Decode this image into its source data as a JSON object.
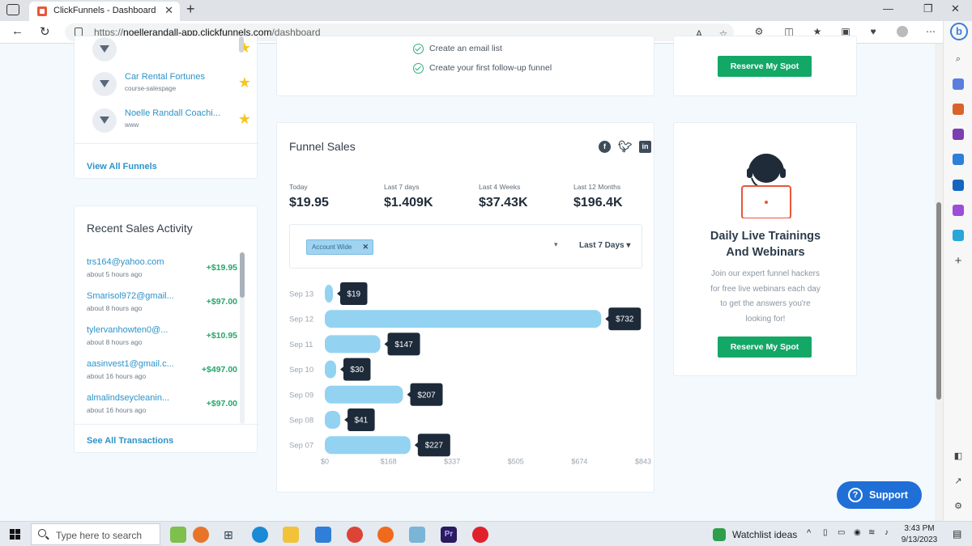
{
  "browser": {
    "tab_title": "ClickFunnels - Dashboard",
    "url_prefix": "https://",
    "url_host": "noellerandall-app.clickfunnels.com",
    "url_path": "/dashboard"
  },
  "funnels": {
    "items": [
      {
        "name": "Car Rental Fortunes",
        "sub": "course-salespage"
      },
      {
        "name": "Noelle Randall Coachi...",
        "sub": "www"
      }
    ],
    "view_all": "View All Funnels"
  },
  "checklist": [
    "Create an email list",
    "Create your first follow-up funnel"
  ],
  "promo_top": {
    "button": "Reserve My Spot"
  },
  "recent_sales": {
    "title": "Recent Sales Activity",
    "items": [
      {
        "email": "trs164@yahoo.com",
        "ago": "about 5 hours ago",
        "amount": "+$19.95"
      },
      {
        "email": "Smarisol972@gmail...",
        "ago": "about 8 hours ago",
        "amount": "+$97.00"
      },
      {
        "email": "tylervanhowten0@...",
        "ago": "about 8 hours ago",
        "amount": "+$10.95"
      },
      {
        "email": "aasinvest1@gmail.c...",
        "ago": "about 16 hours ago",
        "amount": "+$497.00"
      },
      {
        "email": "almalindseycleanin...",
        "ago": "about 16 hours ago",
        "amount": "+$97.00"
      }
    ],
    "see_all": "See All Transactions"
  },
  "funnel_sales": {
    "title": "Funnel Sales",
    "stats": [
      {
        "label": "Today",
        "value": "$19.95"
      },
      {
        "label": "Last 7 days",
        "value": "$1.409K"
      },
      {
        "label": "Last 4 Weeks",
        "value": "$37.43K"
      },
      {
        "label": "Last 12 Months",
        "value": "$196.4K"
      }
    ],
    "filter_chip": "Account Wide",
    "range": "Last 7 Days"
  },
  "chart_data": {
    "type": "bar",
    "orientation": "horizontal",
    "categories": [
      "Sep 13",
      "Sep 12",
      "Sep 11",
      "Sep 10",
      "Sep 09",
      "Sep 08",
      "Sep 07"
    ],
    "values": [
      19,
      732,
      147,
      30,
      207,
      41,
      227
    ],
    "data_labels": [
      "$19",
      "$732",
      "$147",
      "$30",
      "$207",
      "$41",
      "$227"
    ],
    "x_ticks": [
      "$0",
      "$168",
      "$337",
      "$505",
      "$674",
      "$843"
    ],
    "xlim": [
      0,
      843
    ],
    "bar_color": "#93d3f1",
    "label_color": "#1d2a3a",
    "grid": false
  },
  "promo": {
    "title_line1": "Daily Live Trainings",
    "title_line2": "And Webinars",
    "text_lines": [
      "Join our expert funnel hackers",
      "for free live webinars each day",
      "to get the answers you're",
      "looking for!"
    ],
    "button": "Reserve My Spot"
  },
  "support": {
    "label": "Support"
  },
  "taskbar": {
    "search_placeholder": "Type here to search",
    "widget": "Watchlist ideas",
    "time": "3:43 PM",
    "date": "9/13/2023"
  },
  "colors": {
    "accent": "#2d93c9",
    "green": "#14a867",
    "support_blue": "#1f6fd6"
  }
}
